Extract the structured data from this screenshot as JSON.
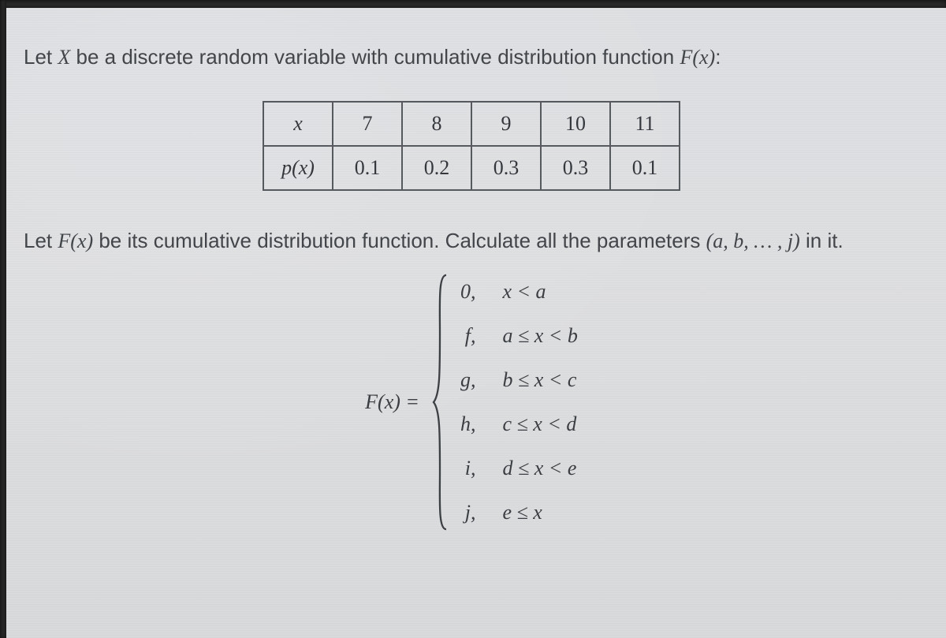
{
  "text": {
    "l1a": "Let ",
    "l1_var": "X",
    "l1b": " be a discrete random variable with cumulative distribution function ",
    "l1_fn": "F(x)",
    "l1c": ":",
    "l2a": "Let ",
    "l2_fn": "F(x)",
    "l2b": " be its cumulative distribution function. Calculate all the parameters ",
    "l2_params": "(a, b, … , j)",
    "l2c": " in it.",
    "eq_label": "F(x) ="
  },
  "table": {
    "header_label": "x",
    "row_label": "p(x)",
    "x": [
      "7",
      "8",
      "9",
      "10",
      "11"
    ],
    "p": [
      "0.1",
      "0.2",
      "0.3",
      "0.3",
      "0.1"
    ]
  },
  "cases": [
    {
      "value": "0,",
      "cond": "x < a"
    },
    {
      "value": "f,",
      "cond": "a ≤ x < b"
    },
    {
      "value": "g,",
      "cond": "b ≤ x < c"
    },
    {
      "value": "h,",
      "cond": "c ≤ x < d"
    },
    {
      "value": "i,",
      "cond": "d ≤ x < e"
    },
    {
      "value": "j,",
      "cond": "e ≤ x"
    }
  ]
}
